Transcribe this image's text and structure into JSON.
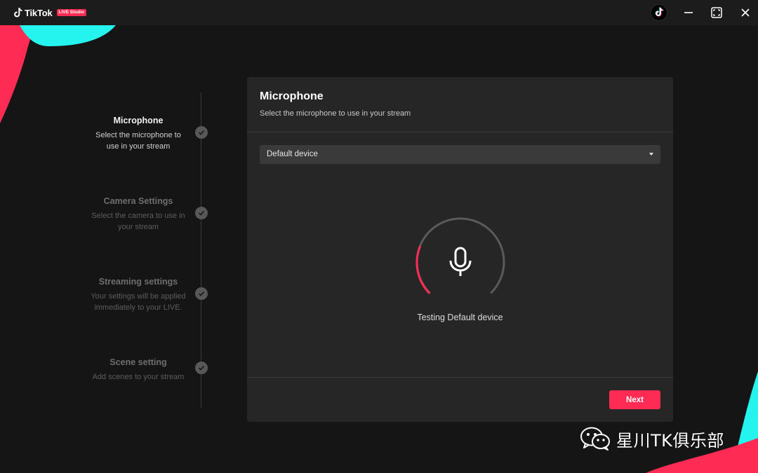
{
  "app": {
    "brand": "TikTok",
    "badge": "LIVE Studio",
    "colors": {
      "accent": "#fe2c55",
      "cyan": "#25f4ee",
      "background": "#151515",
      "card": "#262626"
    }
  },
  "window_controls": {
    "tiktok_icon": "tiktok-logo-icon",
    "minimize_icon": "minimize-icon",
    "maximize_icon": "maximize-icon",
    "close_icon": "close-icon"
  },
  "steps": [
    {
      "title": "Microphone",
      "desc_lines": [
        "Select the microphone to",
        "use in your stream"
      ],
      "active": true
    },
    {
      "title": "Camera Settings",
      "desc_lines": [
        "Select the camera to use in",
        "your stream"
      ],
      "active": false
    },
    {
      "title": "Streaming settings",
      "desc_lines": [
        "Your settings will be applied",
        "immediately to your LIVE."
      ],
      "active": false
    },
    {
      "title": "Scene setting",
      "desc_lines": [
        "Add scenes to your stream"
      ],
      "active": false
    }
  ],
  "panel": {
    "title": "Microphone",
    "subtitle": "Select the microphone to use in your stream",
    "device_select": {
      "value": "Default device",
      "icon": "caret-down-icon"
    },
    "meter": {
      "icon": "microphone-icon",
      "level": 0.25
    },
    "status_text": "Testing Default device",
    "next_label": "Next"
  },
  "watermark": {
    "text": "星川TK俱乐部",
    "icon": "wechat-icon"
  }
}
